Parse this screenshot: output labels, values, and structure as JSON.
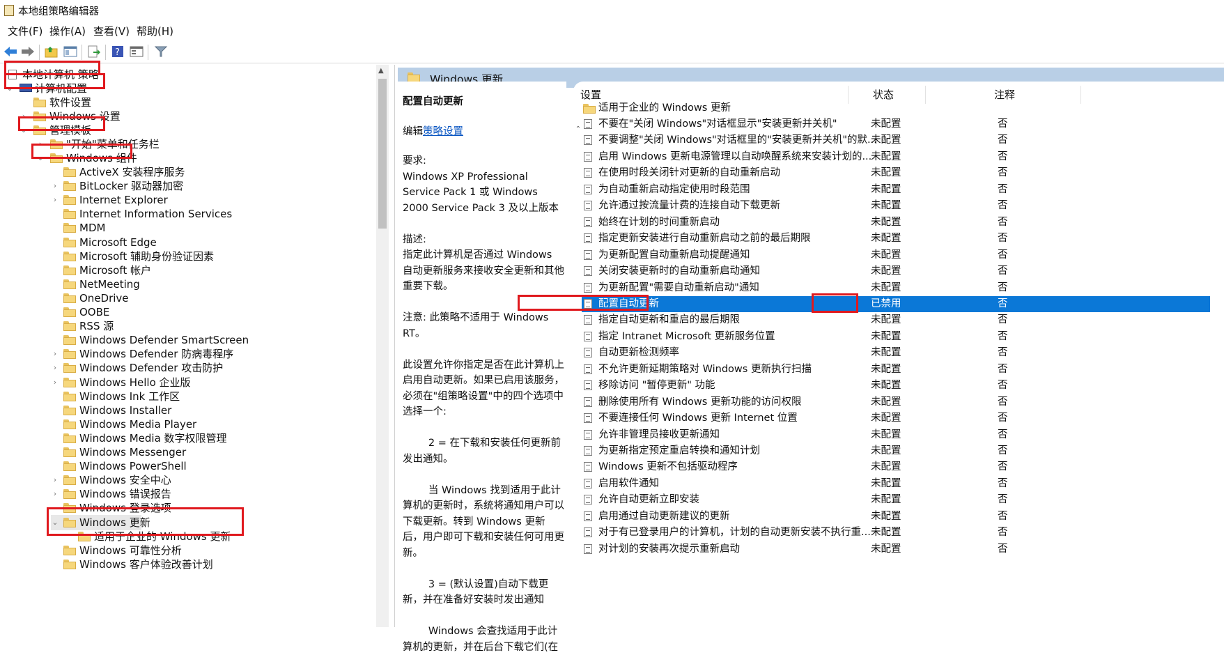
{
  "window": {
    "title": "本地组策略编辑器"
  },
  "menu": [
    "文件(F)",
    "操作(A)",
    "查看(V)",
    "帮助(H)"
  ],
  "toolbar": {
    "buttons": [
      "back-arrow-icon",
      "forward-arrow-icon",
      "up-folder-icon",
      "show-hide-tree-icon",
      "export-list-icon",
      "help-icon",
      "properties-icon",
      "filter-icon"
    ]
  },
  "tree": {
    "root": "本地计算机 策略",
    "computer_config": "计算机配置",
    "software_settings": "软件设置",
    "windows_settings": "Windows 设置",
    "admin_templates": "管理模板",
    "start_menu": "\"开始\"菜单和任务栏",
    "windows_components": "Windows 组件",
    "components": [
      "ActiveX 安装程序服务",
      "BitLocker 驱动器加密",
      "Internet Explorer",
      "Internet Information Services",
      "MDM",
      "Microsoft Edge",
      "Microsoft 辅助身份验证因素",
      "Microsoft 帐户",
      "NetMeeting",
      "OneDrive",
      "OOBE",
      "RSS 源",
      "Windows Defender SmartScreen",
      "Windows Defender 防病毒程序",
      "Windows Defender 攻击防护",
      "Windows Hello 企业版",
      "Windows Ink 工作区",
      "Windows Installer",
      "Windows Media Player",
      "Windows Media 数字权限管理",
      "Windows Messenger",
      "Windows PowerShell",
      "Windows 安全中心",
      "Windows 错误报告",
      "Windows 登录选项",
      "Windows 更新",
      "适用于企业的 Windows 更新",
      "Windows 可靠性分析",
      "Windows 客户体验改善计划"
    ]
  },
  "right": {
    "header_title": "Windows 更新",
    "description": {
      "policy_name": "配置自动更新",
      "edit_prefix": "编辑",
      "edit_link": "策略设置",
      "body": "要求:\nWindows XP Professional Service Pack 1 或 Windows 2000 Service Pack 3 及以上版本\n\n描述:\n指定此计算机是否通过 Windows 自动更新服务来接收安全更新和其他重要下载。\n\n注意: 此策略不适用于 Windows RT。\n\n此设置允许你指定是否在此计算机上启用自动更新。如果已启用该服务，必须在\"组策略设置\"中的四个选项中选择一个:\n\n        2 = 在下载和安装任何更新前发出通知。\n\n        当 Windows 找到适用于此计算机的更新时，系统将通知用户可以下载更新。转到 Windows 更新后，用户即可下载和安装任何可用更新。\n\n        3 = (默认设置)自动下载更新，并在准备好安装时发出通知\n\n        Windows 会查找适用于此计算机的更新，并在后台下载它们(在"
    },
    "columns": {
      "setting": "设置",
      "state": "状态",
      "note": "注释"
    },
    "folder_row": "适用于企业的 Windows 更新",
    "rows": [
      {
        "name": "不要在\"关闭 Windows\"对话框显示\"安装更新并关机\"",
        "state": "未配置",
        "note": "否"
      },
      {
        "name": "不要调整\"关闭 Windows\"对话框里的\"安装更新并关机\"的默...",
        "state": "未配置",
        "note": "否"
      },
      {
        "name": "启用 Windows 更新电源管理以自动唤醒系统来安装计划的...",
        "state": "未配置",
        "note": "否"
      },
      {
        "name": "在使用时段关闭针对更新的自动重新启动",
        "state": "未配置",
        "note": "否"
      },
      {
        "name": "为自动重新启动指定使用时段范围",
        "state": "未配置",
        "note": "否"
      },
      {
        "name": "允许通过按流量计费的连接自动下载更新",
        "state": "未配置",
        "note": "否"
      },
      {
        "name": "始终在计划的时间重新启动",
        "state": "未配置",
        "note": "否"
      },
      {
        "name": "指定更新安装进行自动重新启动之前的最后期限",
        "state": "未配置",
        "note": "否"
      },
      {
        "name": "为更新配置自动重新启动提醒通知",
        "state": "未配置",
        "note": "否"
      },
      {
        "name": "关闭安装更新时的自动重新启动通知",
        "state": "未配置",
        "note": "否"
      },
      {
        "name": "为更新配置\"需要自动重新启动\"通知",
        "state": "未配置",
        "note": "否"
      },
      {
        "name": "配置自动更新",
        "state": "已禁用",
        "note": "否"
      },
      {
        "name": "指定自动更新和重启的最后期限",
        "state": "未配置",
        "note": "否"
      },
      {
        "name": "指定 Intranet Microsoft 更新服务位置",
        "state": "未配置",
        "note": "否"
      },
      {
        "name": "自动更新检测频率",
        "state": "未配置",
        "note": "否"
      },
      {
        "name": "不允许更新延期策略对 Windows 更新执行扫描",
        "state": "未配置",
        "note": "否"
      },
      {
        "name": "移除访问 \"暂停更新\" 功能",
        "state": "未配置",
        "note": "否"
      },
      {
        "name": "删除使用所有 Windows 更新功能的访问权限",
        "state": "未配置",
        "note": "否"
      },
      {
        "name": "不要连接任何 Windows 更新 Internet 位置",
        "state": "未配置",
        "note": "否"
      },
      {
        "name": "允许非管理员接收更新通知",
        "state": "未配置",
        "note": "否"
      },
      {
        "name": "为更新指定预定重启转换和通知计划",
        "state": "未配置",
        "note": "否"
      },
      {
        "name": "Windows 更新不包括驱动程序",
        "state": "未配置",
        "note": "否"
      },
      {
        "name": "启用软件通知",
        "state": "未配置",
        "note": "否"
      },
      {
        "name": "允许自动更新立即安装",
        "state": "未配置",
        "note": "否"
      },
      {
        "name": "启用通过自动更新建议的更新",
        "state": "未配置",
        "note": "否"
      },
      {
        "name": "对于有已登录用户的计算机，计划的自动更新安装不执行重...",
        "state": "未配置",
        "note": "否"
      },
      {
        "name": "对计划的安装再次提示重新启动",
        "state": "未配置",
        "note": "否"
      }
    ],
    "selected_index": 11
  },
  "colors": {
    "selection": "#0b78d7",
    "header": "#b9cfe6",
    "highlight_box": "#e0191e"
  }
}
